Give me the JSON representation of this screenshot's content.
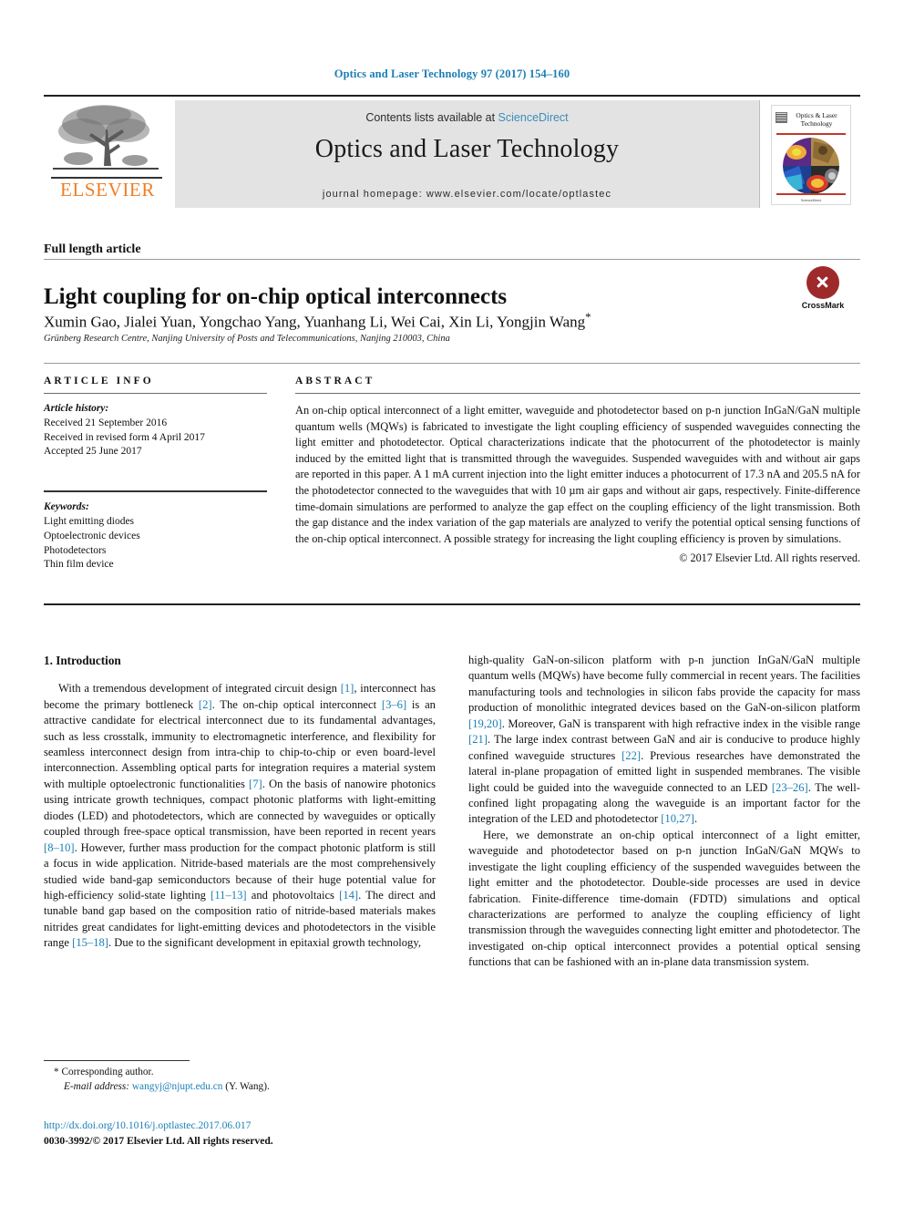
{
  "running_head": "Optics and Laser Technology 97 (2017) 154–160",
  "masthead": {
    "publisher_name": "ELSEVIER",
    "contents_prefix": "Contents lists available at ",
    "contents_link": "ScienceDirect",
    "journal_title": "Optics and Laser Technology",
    "homepage": "journal homepage: www.elsevier.com/locate/optlastec",
    "cover": {
      "line1": "Optics & Laser",
      "line2": "Technology",
      "footer": "ScienceDirect"
    }
  },
  "article": {
    "type": "Full length article",
    "title": "Light coupling for on-chip optical interconnects",
    "authors": "Xumin Gao, Jialei Yuan, Yongchao Yang, Yuanhang Li, Wei Cai, Xin Li, Yongjin Wang",
    "author_star": "*",
    "affiliation": "Grünberg Research Centre, Nanjing University of Posts and Telecommunications, Nanjing 210003, China",
    "crossmark_label": "CrossMark"
  },
  "info": {
    "heading": "ARTICLE INFO",
    "history_label": "Article history:",
    "history": [
      "Received 21 September 2016",
      "Received in revised form 4 April 2017",
      "Accepted 25 June 2017"
    ],
    "keywords_label": "Keywords:",
    "keywords": [
      "Light emitting diodes",
      "Optoelectronic devices",
      "Photodetectors",
      "Thin film device"
    ]
  },
  "abstract": {
    "heading": "ABSTRACT",
    "text": "An on-chip optical interconnect of a light emitter, waveguide and photodetector based on p-n junction InGaN/GaN multiple quantum wells (MQWs) is fabricated to investigate the light coupling efficiency of suspended waveguides connecting the light emitter and photodetector. Optical characterizations indicate that the photocurrent of the photodetector is mainly induced by the emitted light that is transmitted through the waveguides. Suspended waveguides with and without air gaps are reported in this paper. A 1 mA current injection into the light emitter induces a photocurrent of 17.3 nA and 205.5 nA for the photodetector connected to the waveguides that with 10 µm air gaps and without air gaps, respectively. Finite-difference time-domain simulations are performed to analyze the gap effect on the coupling efficiency of the light transmission. Both the gap distance and the index variation of the gap materials are analyzed to verify the potential optical sensing functions of the on-chip optical interconnect. A possible strategy for increasing the light coupling efficiency is proven by simulations.",
    "copyright": "© 2017 Elsevier Ltd. All rights reserved."
  },
  "body": {
    "section_title": "1. Introduction",
    "left_paragraphs": [
      "With a tremendous development of integrated circuit design [1], interconnect has become the primary bottleneck [2]. The on-chip optical interconnect [3–6] is an attractive candidate for electrical interconnect due to its fundamental advantages, such as less crosstalk, immunity to electromagnetic interference, and flexibility for seamless interconnect design from intra-chip to chip-to-chip or even board-level interconnection. Assembling optical parts for integration requires a material system with multiple optoelectronic functionalities [7]. On the basis of nanowire photonics using intricate growth techniques, compact photonic platforms with light-emitting diodes (LED) and photodetectors, which are connected by waveguides or optically coupled through free-space optical transmission, have been reported in recent years [8–10]. However, further mass production for the compact photonic platform is still a focus in wide application. Nitride-based materials are the most comprehensively studied wide band-gap semiconductors because of their huge potential value for high-efficiency solid-state lighting [11–13] and photovoltaics [14]. The direct and tunable band gap based on the composition ratio of nitride-based materials makes nitrides great candidates for light-emitting devices and photodetectors in the visible range [15–18]. Due to the significant development in epitaxial growth technology,"
    ],
    "right_paragraphs": [
      "high-quality GaN-on-silicon platform with p-n junction InGaN/GaN multiple quantum wells (MQWs) have become fully commercial in recent years. The facilities manufacturing tools and technologies in silicon fabs provide the capacity for mass production of monolithic integrated devices based on the GaN-on-silicon platform [19,20]. Moreover, GaN is transparent with high refractive index in the visible range [21]. The large index contrast between GaN and air is conducive to produce highly confined waveguide structures [22]. Previous researches have demonstrated the lateral in-plane propagation of emitted light in suspended membranes. The visible light could be guided into the waveguide connected to an LED [23–26]. The well-confined light propagating along the waveguide is an important factor for the integration of the LED and photodetector [10,27].",
      "Here, we demonstrate an on-chip optical interconnect of a light emitter, waveguide and photodetector based on p-n junction InGaN/GaN MQWs to investigate the light coupling efficiency of the suspended waveguides between the light emitter and the photodetector. Double-side processes are used in device fabrication. Finite-difference time-domain (FDTD) simulations and optical characterizations are performed to analyze the coupling efficiency of light transmission through the waveguides connecting light emitter and photodetector. The investigated on-chip optical interconnect provides a potential optical sensing functions that can be fashioned with an in-plane data transmission system."
    ]
  },
  "footnote": {
    "corresponding_marker": "*",
    "corresponding_text": "Corresponding author.",
    "email_label": "E-mail address:",
    "email": "wangyj@njupt.edu.cn",
    "email_owner": "(Y. Wang)."
  },
  "footer": {
    "doi": "http://dx.doi.org/10.1016/j.optlastec.2017.06.017",
    "issn_line": "0030-3992/© 2017 Elsevier Ltd. All rights reserved."
  },
  "colors": {
    "link_blue": "#1a7fb5",
    "elsevier_orange": "#f07e26",
    "band_gray": "#e3e3e3",
    "crossmark_red": "#9e2a2b"
  }
}
